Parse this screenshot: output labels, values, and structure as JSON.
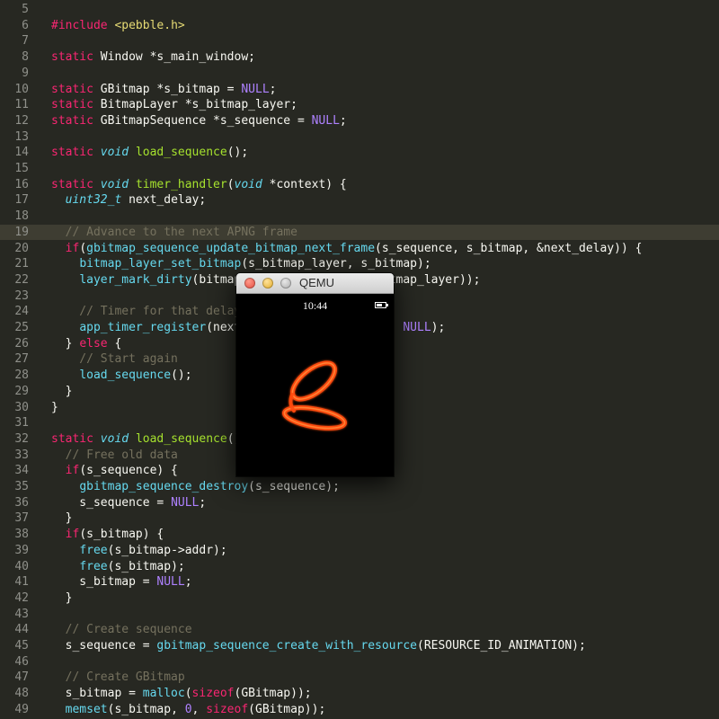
{
  "editor": {
    "current_line": 19,
    "lines": [
      {
        "num": "5",
        "code": []
      },
      {
        "num": "6",
        "code": [
          {
            "t": "#include ",
            "c": "k"
          },
          {
            "t": "<pebble.h>",
            "c": "s"
          }
        ]
      },
      {
        "num": "7",
        "code": []
      },
      {
        "num": "8",
        "code": [
          {
            "t": "static ",
            "c": "k"
          },
          {
            "t": "Window *s_main_window;",
            "c": ""
          }
        ]
      },
      {
        "num": "9",
        "code": []
      },
      {
        "num": "10",
        "code": [
          {
            "t": "static ",
            "c": "k"
          },
          {
            "t": "GBitmap *s_bitmap = ",
            "c": ""
          },
          {
            "t": "NULL",
            "c": "n"
          },
          {
            "t": ";",
            "c": ""
          }
        ]
      },
      {
        "num": "11",
        "code": [
          {
            "t": "static ",
            "c": "k"
          },
          {
            "t": "BitmapLayer *s_bitmap_layer;",
            "c": ""
          }
        ]
      },
      {
        "num": "12",
        "code": [
          {
            "t": "static ",
            "c": "k"
          },
          {
            "t": "GBitmapSequence *s_sequence = ",
            "c": ""
          },
          {
            "t": "NULL",
            "c": "n"
          },
          {
            "t": ";",
            "c": ""
          }
        ]
      },
      {
        "num": "13",
        "code": []
      },
      {
        "num": "14",
        "code": [
          {
            "t": "static ",
            "c": "k"
          },
          {
            "t": "void ",
            "c": "t"
          },
          {
            "t": "load_sequence",
            "c": "f"
          },
          {
            "t": "();",
            "c": ""
          }
        ]
      },
      {
        "num": "15",
        "code": []
      },
      {
        "num": "16",
        "code": [
          {
            "t": "static ",
            "c": "k"
          },
          {
            "t": "void ",
            "c": "t"
          },
          {
            "t": "timer_handler",
            "c": "f"
          },
          {
            "t": "(",
            "c": ""
          },
          {
            "t": "void",
            "c": "t"
          },
          {
            "t": " *context) {",
            "c": ""
          }
        ]
      },
      {
        "num": "17",
        "code": [
          {
            "t": "  ",
            "c": ""
          },
          {
            "t": "uint32_t",
            "c": "t"
          },
          {
            "t": " next_delay;",
            "c": ""
          }
        ]
      },
      {
        "num": "18",
        "code": []
      },
      {
        "num": "19",
        "code": [
          {
            "t": "  // Advance to the next APNG frame",
            "c": "c"
          }
        ]
      },
      {
        "num": "20",
        "code": [
          {
            "t": "  ",
            "c": ""
          },
          {
            "t": "if",
            "c": "k"
          },
          {
            "t": "(",
            "c": ""
          },
          {
            "t": "gbitmap_sequence_update_bitmap_next_frame",
            "c": "b"
          },
          {
            "t": "(s_sequence, s_bitmap, &next_delay)) {",
            "c": ""
          }
        ]
      },
      {
        "num": "21",
        "code": [
          {
            "t": "    ",
            "c": ""
          },
          {
            "t": "bitmap_layer_set_bitmap",
            "c": "b"
          },
          {
            "t": "(s_bitmap_layer, s_bitmap);",
            "c": ""
          }
        ]
      },
      {
        "num": "22",
        "code": [
          {
            "t": "    ",
            "c": ""
          },
          {
            "t": "layer_mark_dirty",
            "c": "b"
          },
          {
            "t": "(bitmap_layer_get_layer(s_bitmap_layer));",
            "c": ""
          }
        ]
      },
      {
        "num": "23",
        "code": []
      },
      {
        "num": "24",
        "code": [
          {
            "t": "    // Timer for that delay",
            "c": "c"
          }
        ]
      },
      {
        "num": "25",
        "code": [
          {
            "t": "    ",
            "c": ""
          },
          {
            "t": "app_timer_register",
            "c": "b"
          },
          {
            "t": "(next_delay, timer_handler, ",
            "c": ""
          },
          {
            "t": "NULL",
            "c": "n"
          },
          {
            "t": ");",
            "c": ""
          }
        ]
      },
      {
        "num": "26",
        "code": [
          {
            "t": "  } ",
            "c": ""
          },
          {
            "t": "else",
            "c": "k"
          },
          {
            "t": " {",
            "c": ""
          }
        ]
      },
      {
        "num": "27",
        "code": [
          {
            "t": "    // Start again",
            "c": "c"
          }
        ]
      },
      {
        "num": "28",
        "code": [
          {
            "t": "    ",
            "c": ""
          },
          {
            "t": "load_sequence",
            "c": "b"
          },
          {
            "t": "();",
            "c": ""
          }
        ]
      },
      {
        "num": "29",
        "code": [
          {
            "t": "  }",
            "c": ""
          }
        ]
      },
      {
        "num": "30",
        "code": [
          {
            "t": "}",
            "c": ""
          }
        ]
      },
      {
        "num": "31",
        "code": []
      },
      {
        "num": "32",
        "code": [
          {
            "t": "static ",
            "c": "k"
          },
          {
            "t": "void ",
            "c": "t"
          },
          {
            "t": "load_sequence",
            "c": "f"
          },
          {
            "t": "() {",
            "c": ""
          }
        ]
      },
      {
        "num": "33",
        "code": [
          {
            "t": "  // Free old data",
            "c": "c"
          }
        ]
      },
      {
        "num": "34",
        "code": [
          {
            "t": "  ",
            "c": ""
          },
          {
            "t": "if",
            "c": "k"
          },
          {
            "t": "(s_sequence) {",
            "c": ""
          }
        ]
      },
      {
        "num": "35",
        "code": [
          {
            "t": "    ",
            "c": ""
          },
          {
            "t": "gbitmap_sequence_destroy",
            "c": "b"
          },
          {
            "t": "(s_sequence);",
            "c": ""
          }
        ]
      },
      {
        "num": "36",
        "code": [
          {
            "t": "    s_sequence = ",
            "c": ""
          },
          {
            "t": "NULL",
            "c": "n"
          },
          {
            "t": ";",
            "c": ""
          }
        ]
      },
      {
        "num": "37",
        "code": [
          {
            "t": "  }",
            "c": ""
          }
        ]
      },
      {
        "num": "38",
        "code": [
          {
            "t": "  ",
            "c": ""
          },
          {
            "t": "if",
            "c": "k"
          },
          {
            "t": "(s_bitmap) {",
            "c": ""
          }
        ]
      },
      {
        "num": "39",
        "code": [
          {
            "t": "    ",
            "c": ""
          },
          {
            "t": "free",
            "c": "b"
          },
          {
            "t": "(s_bitmap->addr);",
            "c": ""
          }
        ]
      },
      {
        "num": "40",
        "code": [
          {
            "t": "    ",
            "c": ""
          },
          {
            "t": "free",
            "c": "b"
          },
          {
            "t": "(s_bitmap);",
            "c": ""
          }
        ]
      },
      {
        "num": "41",
        "code": [
          {
            "t": "    s_bitmap = ",
            "c": ""
          },
          {
            "t": "NULL",
            "c": "n"
          },
          {
            "t": ";",
            "c": ""
          }
        ]
      },
      {
        "num": "42",
        "code": [
          {
            "t": "  }",
            "c": ""
          }
        ]
      },
      {
        "num": "43",
        "code": []
      },
      {
        "num": "44",
        "code": [
          {
            "t": "  // Create sequence",
            "c": "c"
          }
        ]
      },
      {
        "num": "45",
        "code": [
          {
            "t": "  s_sequence = ",
            "c": ""
          },
          {
            "t": "gbitmap_sequence_create_with_resource",
            "c": "b"
          },
          {
            "t": "(RESOURCE_ID_ANIMATION);",
            "c": ""
          }
        ]
      },
      {
        "num": "46",
        "code": []
      },
      {
        "num": "47",
        "code": [
          {
            "t": "  // Create GBitmap",
            "c": "c"
          }
        ]
      },
      {
        "num": "48",
        "code": [
          {
            "t": "  s_bitmap = ",
            "c": ""
          },
          {
            "t": "malloc",
            "c": "b"
          },
          {
            "t": "(",
            "c": ""
          },
          {
            "t": "sizeof",
            "c": "k"
          },
          {
            "t": "(GBitmap));",
            "c": ""
          }
        ]
      },
      {
        "num": "49",
        "code": [
          {
            "t": "  ",
            "c": ""
          },
          {
            "t": "memset",
            "c": "b"
          },
          {
            "t": "(s_bitmap, ",
            "c": ""
          },
          {
            "t": "0",
            "c": "n"
          },
          {
            "t": ", ",
            "c": ""
          },
          {
            "t": "sizeof",
            "c": "k"
          },
          {
            "t": "(GBitmap));",
            "c": ""
          }
        ]
      }
    ]
  },
  "qemu": {
    "title": "QEMU",
    "time": "10:44",
    "battery_level": 0.7
  },
  "colors": {
    "background": "#272822",
    "keyword": "#f92672",
    "type": "#66d9ef",
    "function": "#a6e22e",
    "comment": "#75715e",
    "constant": "#ae81ff",
    "string": "#e6db74",
    "animation": "#ff5a1a"
  }
}
